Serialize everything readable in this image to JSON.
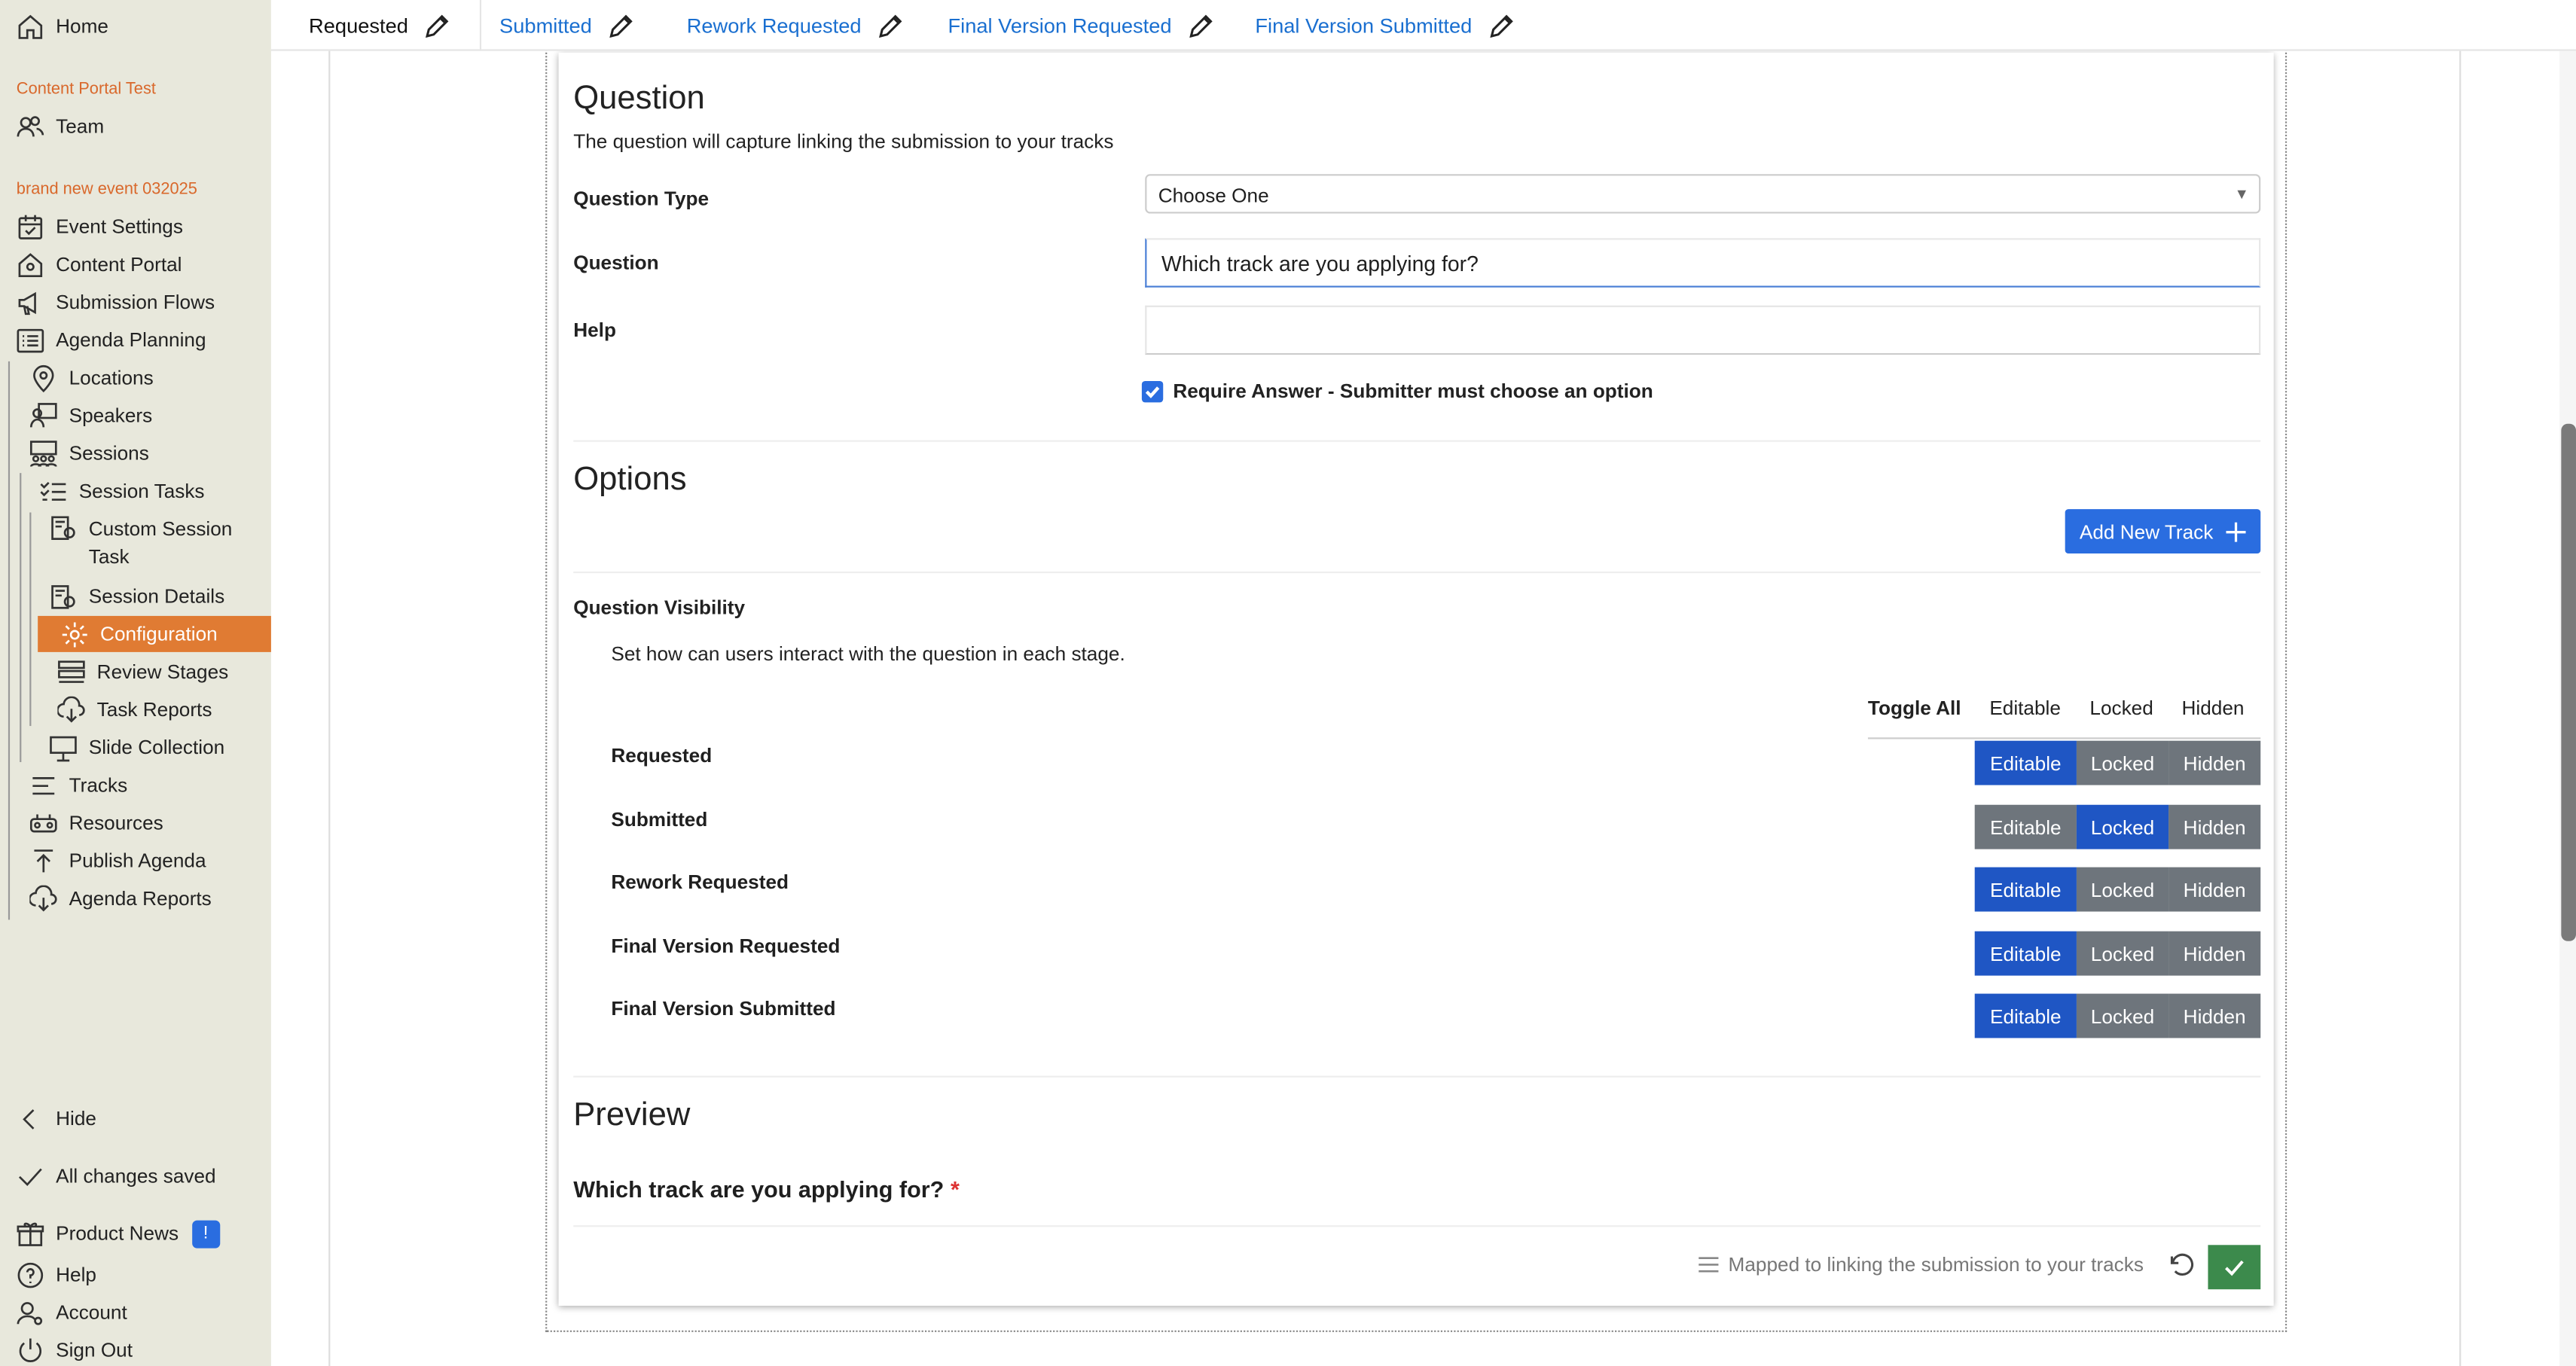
{
  "sidebar": {
    "home": "Home",
    "section1": "Content Portal Test",
    "team": "Team",
    "section2": "brand new event 032025",
    "items": {
      "event_settings": "Event Settings",
      "content_portal": "Content Portal",
      "submission_flows": "Submission Flows",
      "agenda_planning": "Agenda Planning",
      "locations": "Locations",
      "speakers": "Speakers",
      "sessions": "Sessions",
      "session_tasks": "Session Tasks",
      "custom_session_task_1": "Custom Session",
      "custom_session_task_2": "Task",
      "session_details": "Session Details",
      "configuration": "Configuration",
      "review_stages": "Review Stages",
      "task_reports": "Task Reports",
      "slide_collection": "Slide Collection",
      "tracks": "Tracks",
      "resources": "Resources",
      "publish_agenda": "Publish Agenda",
      "agenda_reports": "Agenda Reports"
    },
    "hide": "Hide",
    "saved": "All changes saved",
    "product_news": "Product News",
    "product_news_badge": "!",
    "help": "Help",
    "account": "Account",
    "sign_out": "Sign Out"
  },
  "tabs": [
    "Requested",
    "Submitted",
    "Rework Requested",
    "Final Version Requested",
    "Final Version Submitted"
  ],
  "question": {
    "title": "Question",
    "description": "The question will capture linking the submission to your tracks",
    "type_label": "Question Type",
    "type_value": "Choose One",
    "question_label": "Question",
    "question_value": "Which track are you applying for?",
    "help_label": "Help",
    "help_value": "",
    "require_label": "Require Answer - Submitter must choose an option",
    "require_checked": true
  },
  "options": {
    "title": "Options",
    "add_button": "Add New Track"
  },
  "visibility": {
    "title": "Question Visibility",
    "description": "Set how can users interact with the question in each stage.",
    "toggle_all": "Toggle All",
    "columns": [
      "Editable",
      "Locked",
      "Hidden"
    ],
    "stages": [
      {
        "name": "Requested",
        "selected": "Editable"
      },
      {
        "name": "Submitted",
        "selected": "Locked"
      },
      {
        "name": "Rework Requested",
        "selected": "Editable"
      },
      {
        "name": "Final Version Requested",
        "selected": "Editable"
      },
      {
        "name": "Final Version Submitted",
        "selected": "Editable"
      }
    ]
  },
  "preview": {
    "title": "Preview",
    "question": "Which track are you applying for?",
    "required_mark": "*"
  },
  "footer": {
    "mapped_note": "Mapped to linking the submission to your tracks"
  },
  "colors": {
    "accent_orange": "#e07b33",
    "primary_blue": "#2a6de0",
    "selected_blue": "#1f56c4",
    "unselected_gray": "#6e757c",
    "confirm_green": "#3c8a4c"
  }
}
